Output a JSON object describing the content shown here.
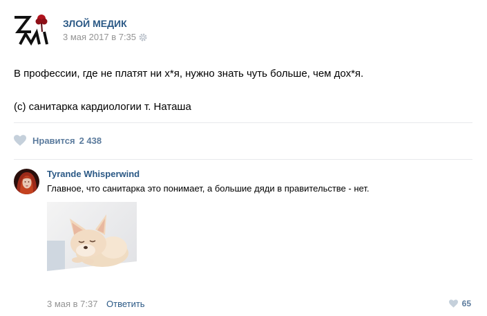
{
  "post": {
    "group_name": "ЗЛОЙ МЕДИК",
    "logo_text": "ЗМ",
    "date": "3 мая 2017 в 7:35",
    "text_lines": [
      "В профессии, где не платят ни х*я, нужно знать чуть больше, чем дох*я.",
      "(с) санитарка кардиологии т. Наташа"
    ],
    "likes": {
      "label": "Нравится",
      "count": "2 438"
    }
  },
  "comment": {
    "author": "Tyrande Whisperwind",
    "text": "Главное, что санитарка это понимает, а большие дяди в правительстве - нет.",
    "photo_subject": "fennec-fox",
    "date": "3 мая в 7:37",
    "reply_label": "Ответить",
    "likes": "65"
  },
  "colors": {
    "link": "#2a5885",
    "muted": "#939393",
    "like": "#5b7b9d",
    "heart": "#c5d0db",
    "divider": "#e7e8ec",
    "logo_rose": "#b0131d"
  },
  "icons": [
    "group-logo-icon",
    "gear-icon",
    "heart-icon",
    "avatar-icon",
    "fox-photo"
  ]
}
